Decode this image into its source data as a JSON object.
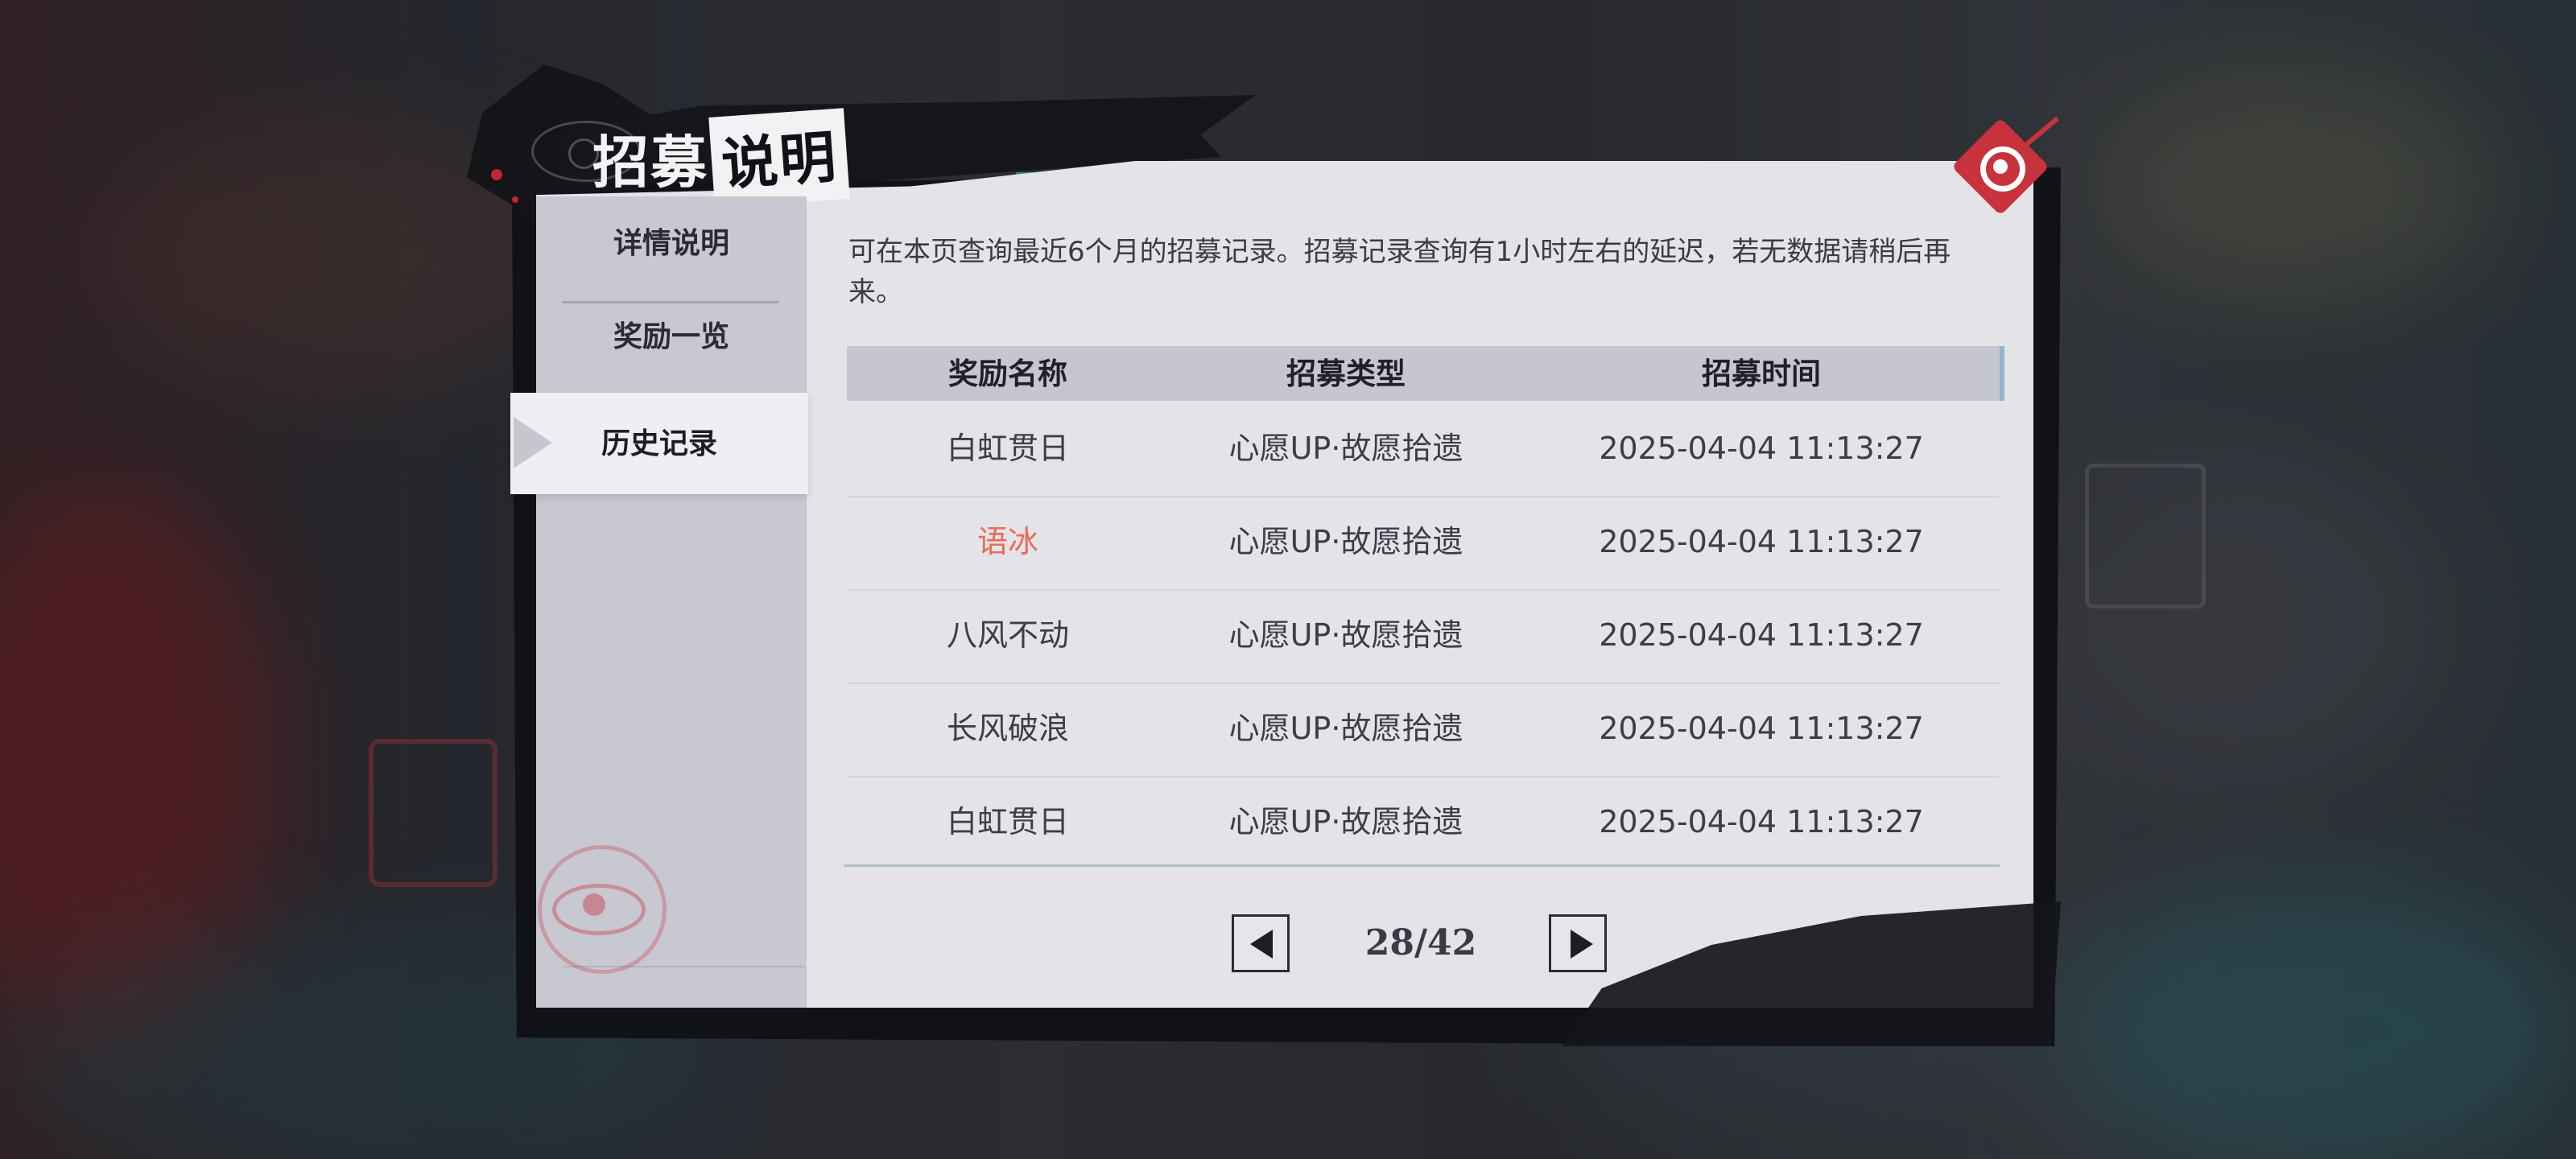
{
  "dialog": {
    "title_part1": "招募",
    "title_part2": "说明"
  },
  "sidebar": {
    "items": [
      {
        "label": "详情说明"
      },
      {
        "label": "奖励一览"
      },
      {
        "label": "历史记录"
      }
    ],
    "active_index": 2
  },
  "history": {
    "description": "可在本页查询最近6个月的招募记录。招募记录查询有1小时左右的延迟，若无数据请稍后再来。",
    "columns": [
      "奖励名称",
      "招募类型",
      "招募时间"
    ],
    "rows": [
      {
        "name": "白虹贯日",
        "type": "心愿UP·故愿拾遗",
        "time": "2025-04-04 11:13:27"
      },
      {
        "name": "语冰",
        "type": "心愿UP·故愿拾遗",
        "time": "2025-04-04 11:13:27"
      },
      {
        "name": "八风不动",
        "type": "心愿UP·故愿拾遗",
        "time": "2025-04-04 11:13:27"
      },
      {
        "name": "长风破浪",
        "type": "心愿UP·故愿拾遗",
        "time": "2025-04-04 11:13:27"
      },
      {
        "name": "白虹贯日",
        "type": "心愿UP·故愿拾遗",
        "time": "2025-04-04 11:13:27"
      }
    ],
    "highlight_color": "#ec6b57"
  },
  "pagination": {
    "indicator": "28/42",
    "current": 28,
    "total": 42,
    "prev_icon": "left-arrow-icon",
    "next_icon": "right-arrow-icon"
  },
  "close_icon": "close-eye-emblem-icon",
  "colors": {
    "accent_red": "#c8323c",
    "panel": "#e3e3e8",
    "sidebar": "#c8c8d1"
  }
}
